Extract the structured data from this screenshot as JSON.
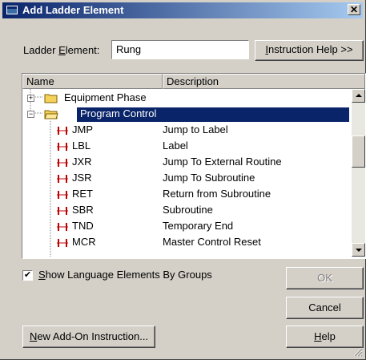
{
  "window": {
    "title": "Add Ladder Element",
    "close_label": "✕"
  },
  "ladder_element": {
    "label_pre": "Ladder ",
    "label_u": "E",
    "label_post": "lement:",
    "value": "Rung"
  },
  "instruction_help": {
    "label_u": "I",
    "label_post": "nstruction Help >>"
  },
  "list": {
    "columns": [
      "Name",
      "Description"
    ],
    "rows": [
      {
        "name": "Equipment Phase",
        "description": "",
        "type": "folder",
        "expander": "+"
      },
      {
        "name": "Program Control",
        "description": "",
        "type": "folder-open",
        "expander": "−",
        "selected": true
      },
      {
        "name": "JMP",
        "description": "Jump to Label",
        "type": "instruction"
      },
      {
        "name": "LBL",
        "description": "Label",
        "type": "instruction"
      },
      {
        "name": "JXR",
        "description": "Jump To External Routine",
        "type": "instruction"
      },
      {
        "name": "JSR",
        "description": "Jump To Subroutine",
        "type": "instruction"
      },
      {
        "name": "RET",
        "description": "Return from Subroutine",
        "type": "instruction"
      },
      {
        "name": "SBR",
        "description": "Subroutine",
        "type": "instruction"
      },
      {
        "name": "TND",
        "description": "Temporary End",
        "type": "instruction"
      },
      {
        "name": "MCR",
        "description": "Master Control Reset",
        "type": "instruction"
      }
    ]
  },
  "show_groups": {
    "checked": true,
    "check_mark": "✔",
    "label_u": "S",
    "label_post": "how Language Elements By Groups"
  },
  "buttons": {
    "ok": "OK",
    "cancel": "Cancel",
    "help_u": "H",
    "help_post": "elp",
    "new_addon_u": "N",
    "new_addon_post": "ew Add-On Instruction..."
  },
  "colors": {
    "selection": "#0a246a",
    "dialog_bg": "#d4d0c8",
    "title_start": "#0a246a",
    "title_end": "#a6caf0",
    "rung_icon": "#c00000",
    "folder": "#f5d25a"
  }
}
